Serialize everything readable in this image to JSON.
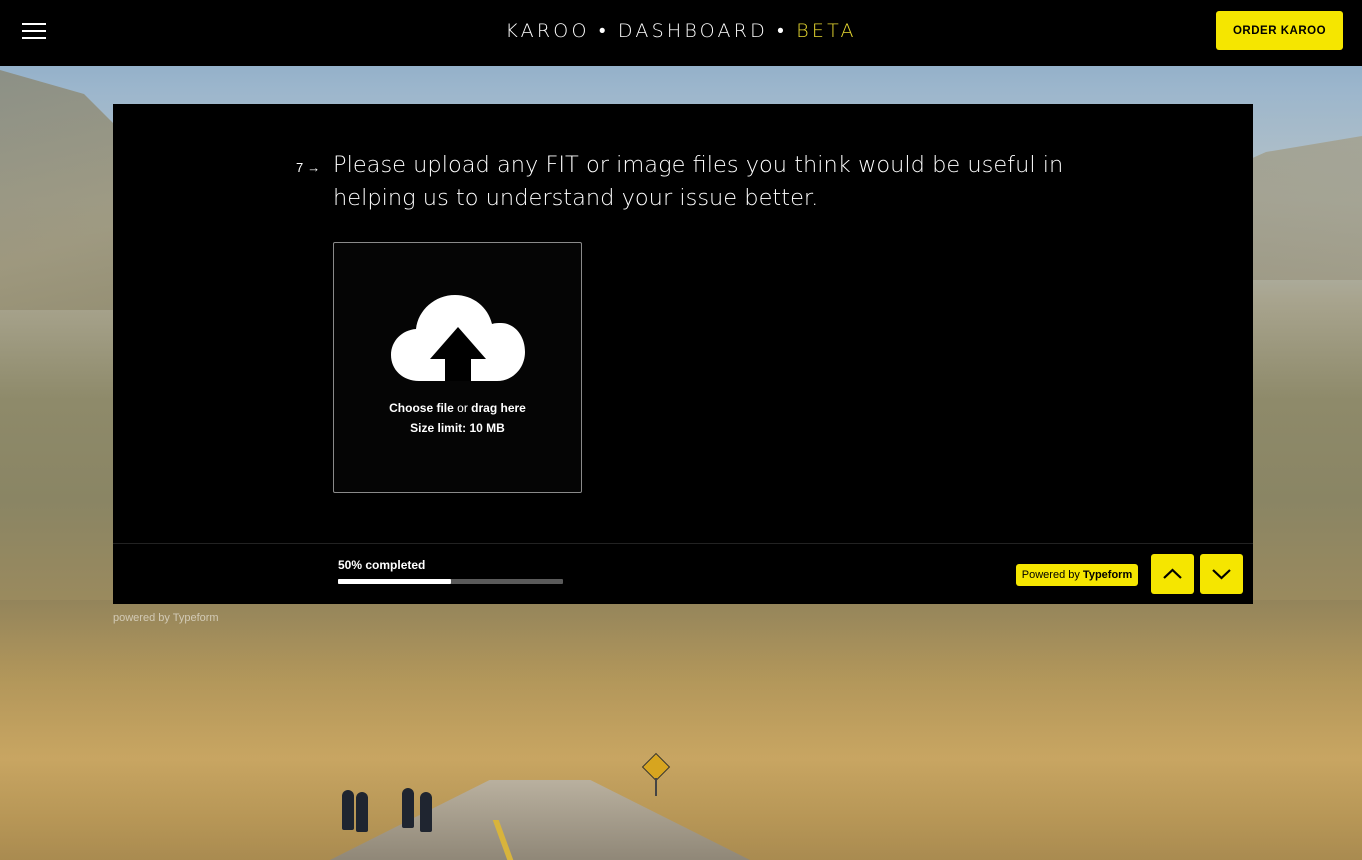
{
  "header": {
    "menu_icon": "hamburger-menu-icon",
    "brand_main": "KAROO • DASHBOARD • ",
    "brand_beta": "BETA",
    "order_button": "ORDER KAROO",
    "beta_color": "#e8d930",
    "accent_color": "#f5e600"
  },
  "form": {
    "question_number": "7",
    "question_arrow": "→",
    "question_text": "Please upload any FIT or image files you think would be useful in helping us to understand your issue better.",
    "upload": {
      "icon": "cloud-upload-icon",
      "choose_file": "Choose file",
      "or": " or ",
      "drag_here": "drag here",
      "size_limit": "Size limit: 10 MB"
    }
  },
  "footer": {
    "progress_text": "50% completed",
    "progress_fraction": 0.5,
    "powered_by_prefix": "Powered by ",
    "powered_by_brand": "Typeform",
    "up_icon": "chevron-up-icon",
    "down_icon": "chevron-down-icon"
  },
  "below_card": {
    "powered_small": "powered by Typeform"
  }
}
